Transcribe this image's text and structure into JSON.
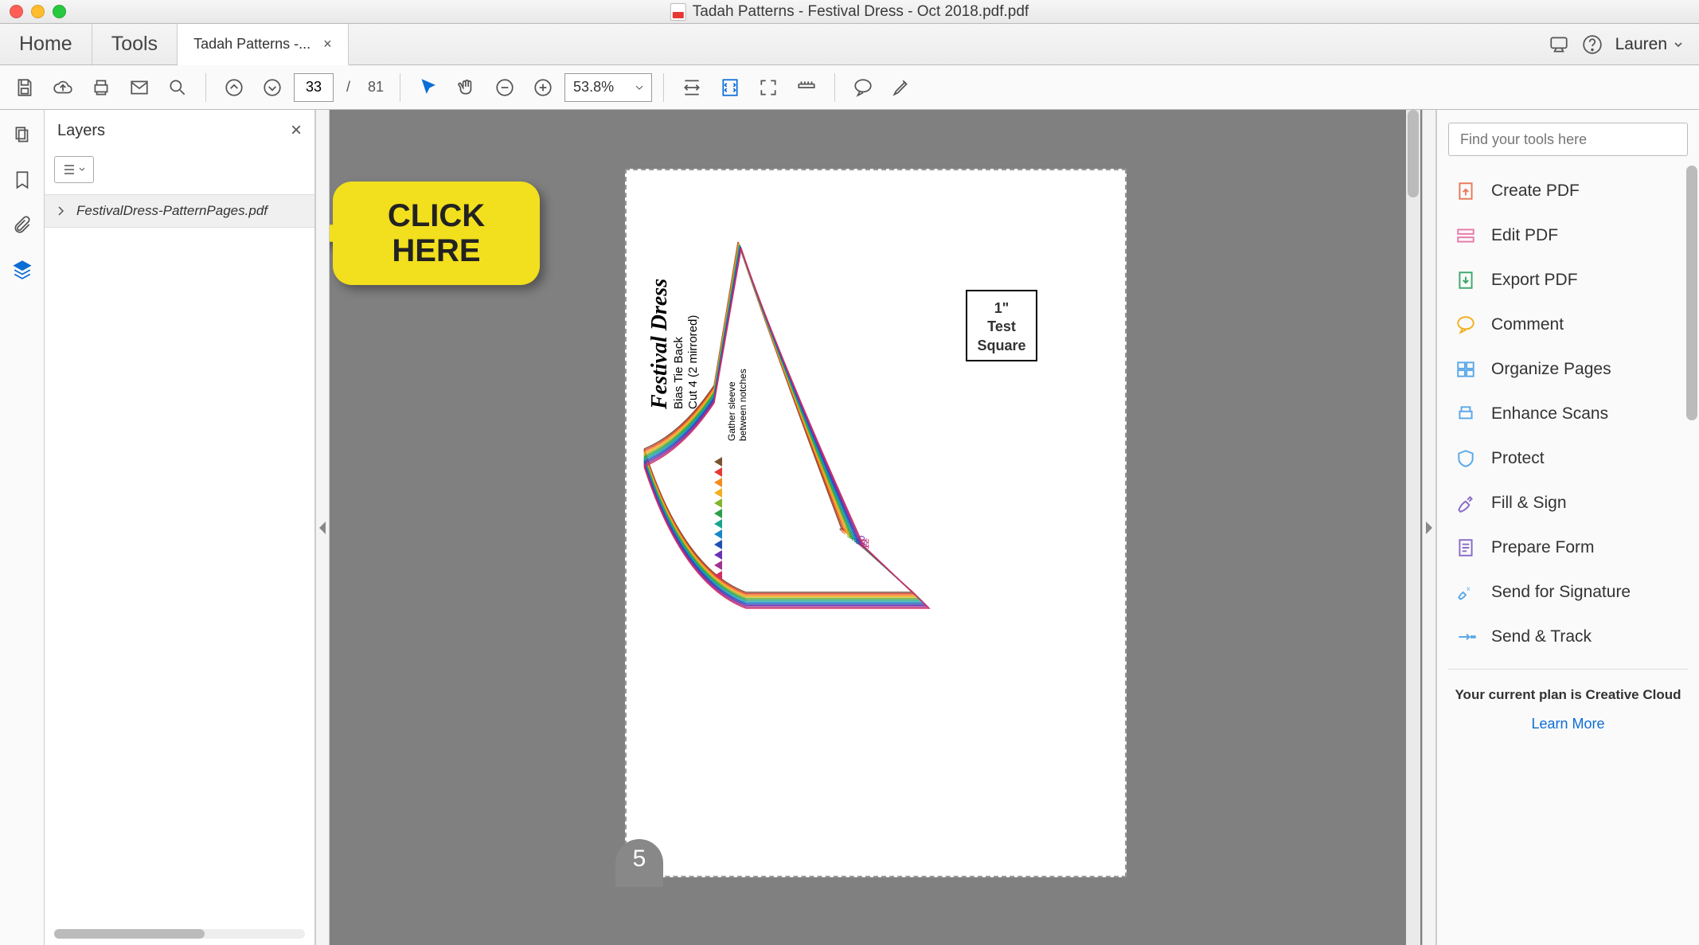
{
  "window": {
    "title": "Tadah Patterns - Festival Dress - Oct 2018.pdf.pdf"
  },
  "tabs": {
    "home": "Home",
    "tools": "Tools",
    "doc_short": "Tadah Patterns -..."
  },
  "user": {
    "name": "Lauren"
  },
  "toolbar": {
    "page_current": "33",
    "page_total": "81",
    "page_sep": "/",
    "zoom": "53.8%"
  },
  "layers_panel": {
    "title": "Layers",
    "item": "FestivalDress-PatternPages.pdf"
  },
  "callout": {
    "line1": "CLICK",
    "line2": "HERE"
  },
  "page_content": {
    "test_square_l1": "1\"",
    "test_square_l2": "Test",
    "test_square_l3": "Square",
    "page_marker": "5",
    "title_script": "Festival Dress",
    "subtitle1": "Bias Tie Back",
    "subtitle2": "Cut 4 (2 mirrored)",
    "note1": "Gather sleeve",
    "note2": "between notches",
    "size_labels": [
      "1",
      "2",
      "3",
      "4",
      "5",
      "6",
      "7",
      "8",
      "9",
      "10",
      "11",
      "12"
    ]
  },
  "right_panel": {
    "search_placeholder": "Find your tools here",
    "items": [
      "Create PDF",
      "Edit PDF",
      "Export PDF",
      "Comment",
      "Organize Pages",
      "Enhance Scans",
      "Protect",
      "Fill & Sign",
      "Prepare Form",
      "Send for Signature",
      "Send & Track"
    ],
    "plan": "Your current plan is Creative Cloud",
    "learn_more": "Learn More"
  },
  "colors": {
    "sizes": [
      "#7a5230",
      "#e53935",
      "#f28c1e",
      "#f2b01e",
      "#84b52e",
      "#2e9e4a",
      "#1aa58f",
      "#1787c9",
      "#1e4fb3",
      "#6a32b3",
      "#a0328f",
      "#d32f63"
    ]
  }
}
